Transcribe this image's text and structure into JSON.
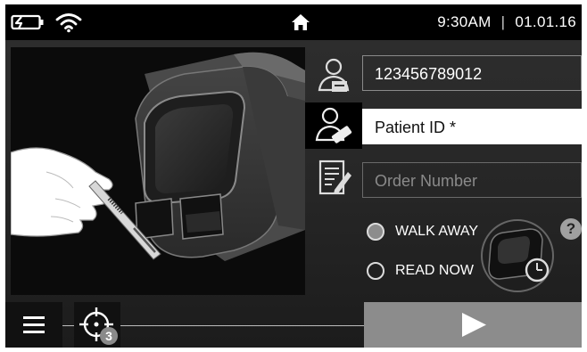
{
  "status_bar": {
    "battery_icon": "battery-charging-icon",
    "wifi_icon": "wifi-icon",
    "home_icon": "home-icon",
    "time": "9:30AM",
    "separator": "|",
    "date": "01.01.16"
  },
  "form": {
    "operator_id": {
      "icon": "operator-id-icon",
      "value": "123456789012"
    },
    "patient_id": {
      "icon": "patient-id-icon",
      "placeholder": "Patient ID *"
    },
    "order_number": {
      "icon": "order-number-icon",
      "placeholder": "Order Number"
    }
  },
  "read_mode": {
    "options": [
      {
        "label": "WALK AWAY",
        "selected": true
      },
      {
        "label": "READ NOW",
        "selected": false
      }
    ],
    "help_label": "?"
  },
  "illustration": {
    "description_icon": "insert-test-strip-illustration"
  },
  "toolbar": {
    "menu_icon": "hamburger-menu-icon",
    "target_icon": "crosshair-target-icon",
    "badge_count": "3",
    "play_icon": "play-icon"
  },
  "colors": {
    "background": "#262626",
    "status_bar": "#000000",
    "active_field": "#ffffff",
    "button_gray": "#8c8c8c",
    "text": "#ffffff"
  }
}
